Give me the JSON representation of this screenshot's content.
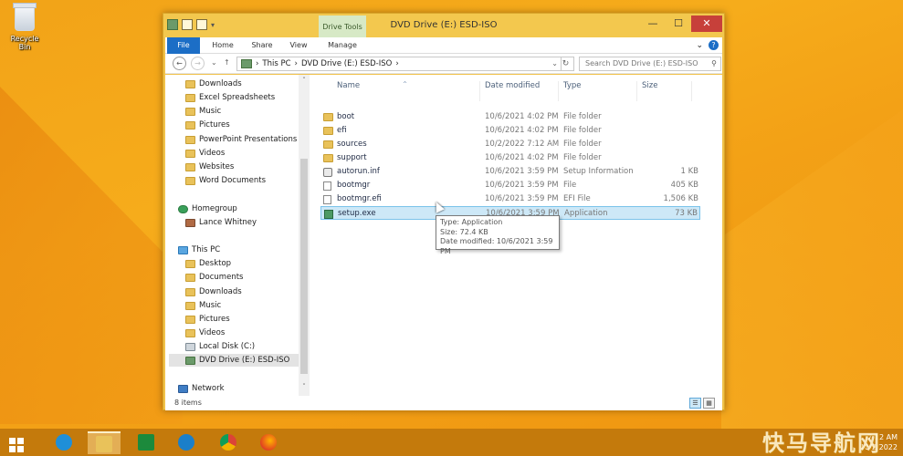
{
  "desktop": {
    "recycle_bin_label": "Recycle Bin"
  },
  "window": {
    "title": "DVD Drive (E:) ESD-ISO",
    "contextual_tab": "Drive Tools",
    "controls": {
      "minimize": "—",
      "maximize": "☐",
      "close": "✕"
    }
  },
  "ribbon": {
    "tabs": [
      "File",
      "Home",
      "Share",
      "View",
      "Manage"
    ],
    "collapse_glyph": "⌄",
    "help_glyph": "?"
  },
  "navigation": {
    "back": "←",
    "forward": "→",
    "recent": "⌄",
    "up": "↑",
    "breadcrumb": [
      "This PC",
      "DVD Drive (E:) ESD-ISO"
    ],
    "separator": "›",
    "dropdown": "⌄",
    "refresh": "↻",
    "search_placeholder": "Search DVD Drive (E:) ESD-ISO",
    "search_glyph": "⚲"
  },
  "nav_pane": {
    "quick_items": [
      "Downloads",
      "Excel Spreadsheets",
      "Music",
      "Pictures",
      "PowerPoint Presentations",
      "Videos",
      "Websites",
      "Word Documents"
    ],
    "homegroup": "Homegroup",
    "user": "Lance Whitney",
    "this_pc": "This PC",
    "pc_items": [
      "Desktop",
      "Documents",
      "Downloads",
      "Music",
      "Pictures",
      "Videos",
      "Local Disk (C:)",
      "DVD Drive (E:) ESD-ISO"
    ],
    "network": "Network",
    "scroll_up": "˄",
    "scroll_down": "˅"
  },
  "columns": {
    "name": "Name",
    "date": "Date modified",
    "type": "Type",
    "size": "Size",
    "sort_glyph": "^"
  },
  "files": [
    {
      "name": "boot",
      "date": "10/6/2021 4:02 PM",
      "type": "File folder",
      "size": "",
      "icon": "folder-icon"
    },
    {
      "name": "efi",
      "date": "10/6/2021 4:02 PM",
      "type": "File folder",
      "size": "",
      "icon": "folder-icon"
    },
    {
      "name": "sources",
      "date": "10/2/2022 7:12 AM",
      "type": "File folder",
      "size": "",
      "icon": "folder-icon"
    },
    {
      "name": "support",
      "date": "10/6/2021 4:02 PM",
      "type": "File folder",
      "size": "",
      "icon": "folder-icon"
    },
    {
      "name": "autorun.inf",
      "date": "10/6/2021 3:59 PM",
      "type": "Setup Information",
      "size": "1 KB",
      "icon": "settings-file-icon"
    },
    {
      "name": "bootmgr",
      "date": "10/6/2021 3:59 PM",
      "type": "File",
      "size": "405 KB",
      "icon": "file-icon"
    },
    {
      "name": "bootmgr.efi",
      "date": "10/6/2021 3:59 PM",
      "type": "EFI File",
      "size": "1,506 KB",
      "icon": "file-icon"
    },
    {
      "name": "setup.exe",
      "date": "10/6/2021 3:59 PM",
      "type": "Application",
      "size": "73 KB",
      "icon": "setup-exe-icon",
      "selected": true
    }
  ],
  "tooltip": {
    "type": "Type: Application",
    "size": "Size: 72.4 KB",
    "date": "Date modified: 10/6/2021 3:59 PM"
  },
  "status": {
    "count": "8 items",
    "details_view_glyph": "☰",
    "icons_view_glyph": "▦"
  },
  "taskbar": {
    "time": "7:12 AM",
    "date": "10/2/2022",
    "watermark": "快马导航网"
  }
}
